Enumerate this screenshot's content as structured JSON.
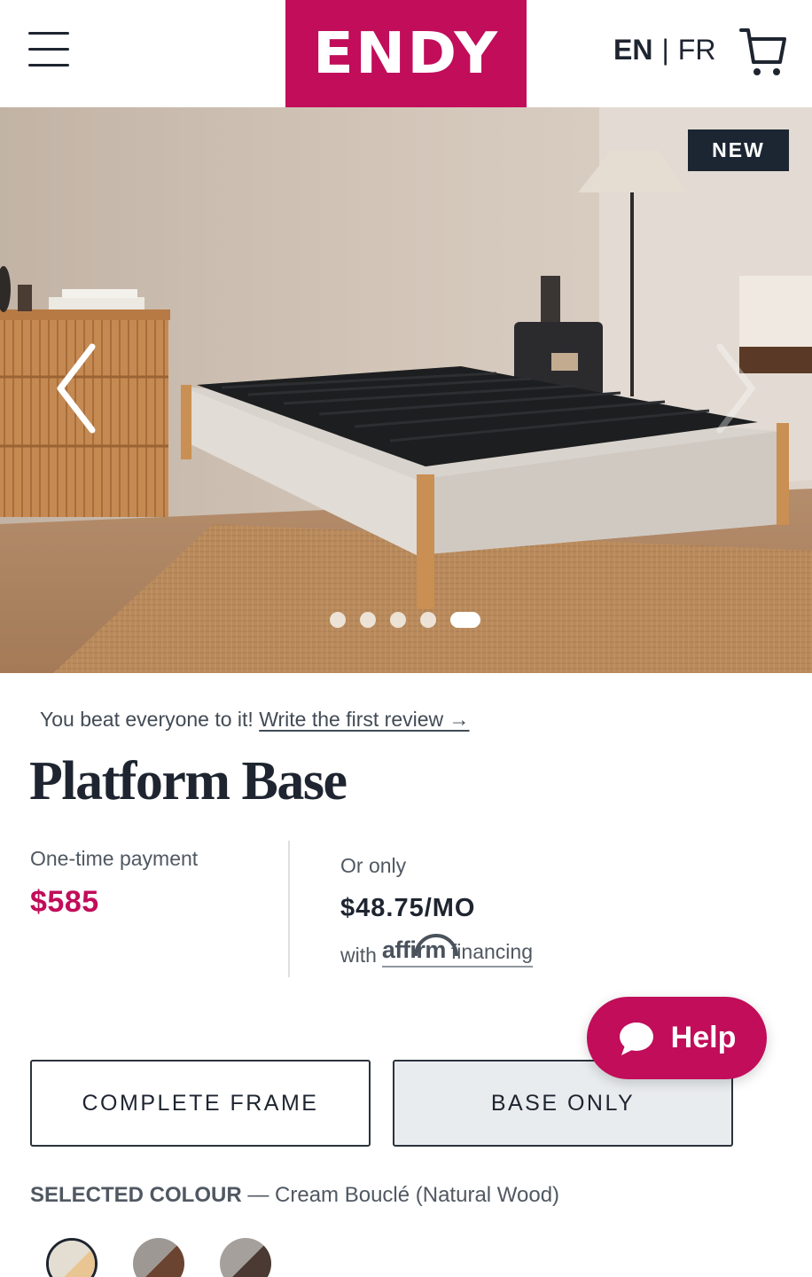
{
  "header": {
    "logo": "ENDY",
    "lang_en": "EN",
    "lang_sep": "|",
    "lang_fr": "FR"
  },
  "hero": {
    "badge": "NEW",
    "slide_count": 5,
    "active_slide": 5
  },
  "product": {
    "review_prefix": "You beat everyone to it!",
    "review_link": "Write the first review →",
    "title": "Platform Base"
  },
  "pricing": {
    "one_time_label": "One-time payment",
    "one_time_price": "$585",
    "financing_label": "Or only",
    "financing_price": "$48.75/MO",
    "financing_prefix": "with",
    "financing_brand": "affirm",
    "financing_suffix": "financing"
  },
  "options": {
    "complete_frame": "COMPLETE FRAME",
    "base_only": "BASE ONLY",
    "selected": "base_only"
  },
  "help": {
    "label": "Help"
  },
  "colour": {
    "label": "SELECTED COLOUR",
    "separator": "—",
    "value": "Cream Bouclé (Natural Wood)"
  },
  "colors": {
    "brand": "#c10d5a",
    "text": "#1e2530",
    "badge_bg": "#1c2632"
  }
}
